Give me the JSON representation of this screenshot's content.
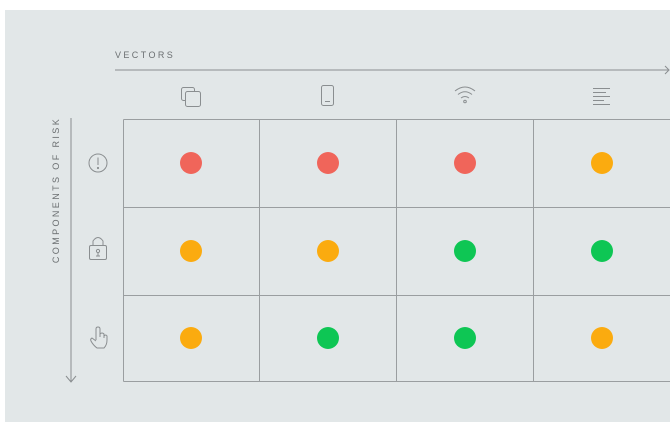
{
  "axes": {
    "x_label": "VECTORS",
    "y_label": "COMPONENTS OF RISK"
  },
  "columns": [
    {
      "icon": "copy-icon"
    },
    {
      "icon": "mobile-phone-icon"
    },
    {
      "icon": "wifi-icon"
    },
    {
      "icon": "text-lines-icon"
    }
  ],
  "rows": [
    {
      "icon": "exclamation-circle-icon"
    },
    {
      "icon": "padlock-icon"
    },
    {
      "icon": "hand-pointer-icon"
    }
  ],
  "status_colors": {
    "red": "#f0655a",
    "orange": "#fbab0f",
    "green": "#0ec654"
  },
  "matrix": [
    [
      "red",
      "red",
      "red",
      "orange"
    ],
    [
      "orange",
      "orange",
      "green",
      "green"
    ],
    [
      "orange",
      "green",
      "green",
      "orange"
    ]
  ]
}
